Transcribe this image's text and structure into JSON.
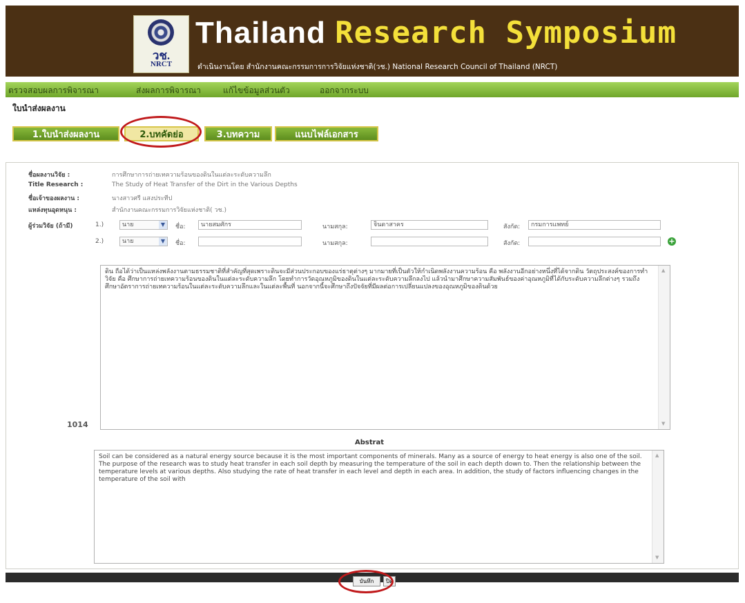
{
  "header": {
    "logo_abbr": "วช.",
    "logo_en": "NRCT",
    "title_part1": "Thailand ",
    "title_part2": "Research Symposium",
    "subtitle": "ดำเนินงานโดย สำนักงานคณะกรรมการการวิจัยแห่งชาติ(วช.) National Research Council of Thailand (NRCT)"
  },
  "menu": {
    "items": [
      "ตรวจสอบผลการพิจารณา",
      "ส่งผลการพิจารณา",
      "แก้ไขข้อมูลส่วนตัว",
      "ออกจากระบบ"
    ]
  },
  "page_title": "ใบนำส่งผลงาน",
  "tabs": [
    "1.ใบนำส่งผลงาน",
    "2.บทคัดย่อ",
    "3.บทความ",
    "แนบไฟล์เอกสาร"
  ],
  "active_tab_index": 1,
  "form": {
    "thai_title_label": "ชื่อผลงานวิจัย :",
    "thai_title_value": "การศึกษาการถ่ายเทความร้อนของดินในแต่ละระดับความลึก",
    "eng_title_label": "Title Research :",
    "eng_title_value": "The Study of Heat Transfer of the Dirt in the Various Depths",
    "owner_label": "ชื่อเจ้าของผลงาน :",
    "owner_value": "นางสาวศรี แสงประทีป",
    "funding_label": "แหล่งทุนอุดหนุน :",
    "funding_value": "สำนักงานคณะกรรมการวิจัยแห่งชาติ( วช.)",
    "coresearch_label": "ผู้ร่วมวิจัย (ถ้ามี)",
    "rows": [
      {
        "num": "1.)",
        "prefix": "นาย",
        "name_label": "ชื่อ:",
        "name": "นายสมศักร",
        "surname_label": "นามสกุล:",
        "surname": "จินดาสาคร",
        "affil_label": "สังกัด:",
        "affil": "กรมการแพทย์"
      },
      {
        "num": "2.)",
        "prefix": "นาย",
        "name_label": "ชื่อ:",
        "name": "",
        "surname_label": "นามสกุล:",
        "surname": "",
        "affil_label": "สังกัด:",
        "affil": ""
      }
    ]
  },
  "thai_abstract": {
    "text": "ดิน ถือได้ว่าเป็นแหล่งพลังงานตามธรรมชาติที่สำคัญที่สุดเพราะดินจะมีส่วนประกอบของแร่ธาตุต่างๆ มากมายที่เป็นตัวให้กำเนิดพลังงานความร้อน คือ พลังงานอีกอย่างหนึ่งที่ได้จากดิน วัตถุประสงค์ของการทำวิจัย คือ ศึกษาการถ่ายเทความร้อนของดินในแต่ละระดับความลึก โดยทำการวัดอุณหภูมิของดินในแต่ละระดับความลึกลงไป แล้วนำมาศึกษาความสัมพันธ์ของค่าอุณหภูมิที่ได้กับระดับความลึกต่างๆ รวมถึงศึกษาอัตราการถ่ายเทความร้อนในแต่ละระดับความลึกและในแต่ละพื้นที่ นอกจากนี้จะศึกษาถึงปัจจัยที่มีผลต่อการเปลี่ยนแปลงของอุณหภูมิของดินด้วย",
    "count": "1014"
  },
  "abstract": {
    "heading": "Abstrat",
    "text": "Soil can be considered as a natural energy source because it is the most important components of minerals. Many as a source of energy to heat energy is also one of the soil. The purpose of the research was to study heat transfer in each soil depth by measuring the temperature of the soil in each depth down to. Then the relationship between the temperature levels at various depths. Also studying the rate of heat transfer in each level and depth in each area. In addition, the study of factors influencing changes in the temperature of the soil with"
  },
  "buttons": {
    "save": "บันทึก",
    "other": "ปิด"
  },
  "colors": {
    "header_bg": "#4b3014",
    "accent_green": "#6fa62a",
    "title_yellow": "#f4e03a",
    "highlight_ring": "#c0191b"
  }
}
